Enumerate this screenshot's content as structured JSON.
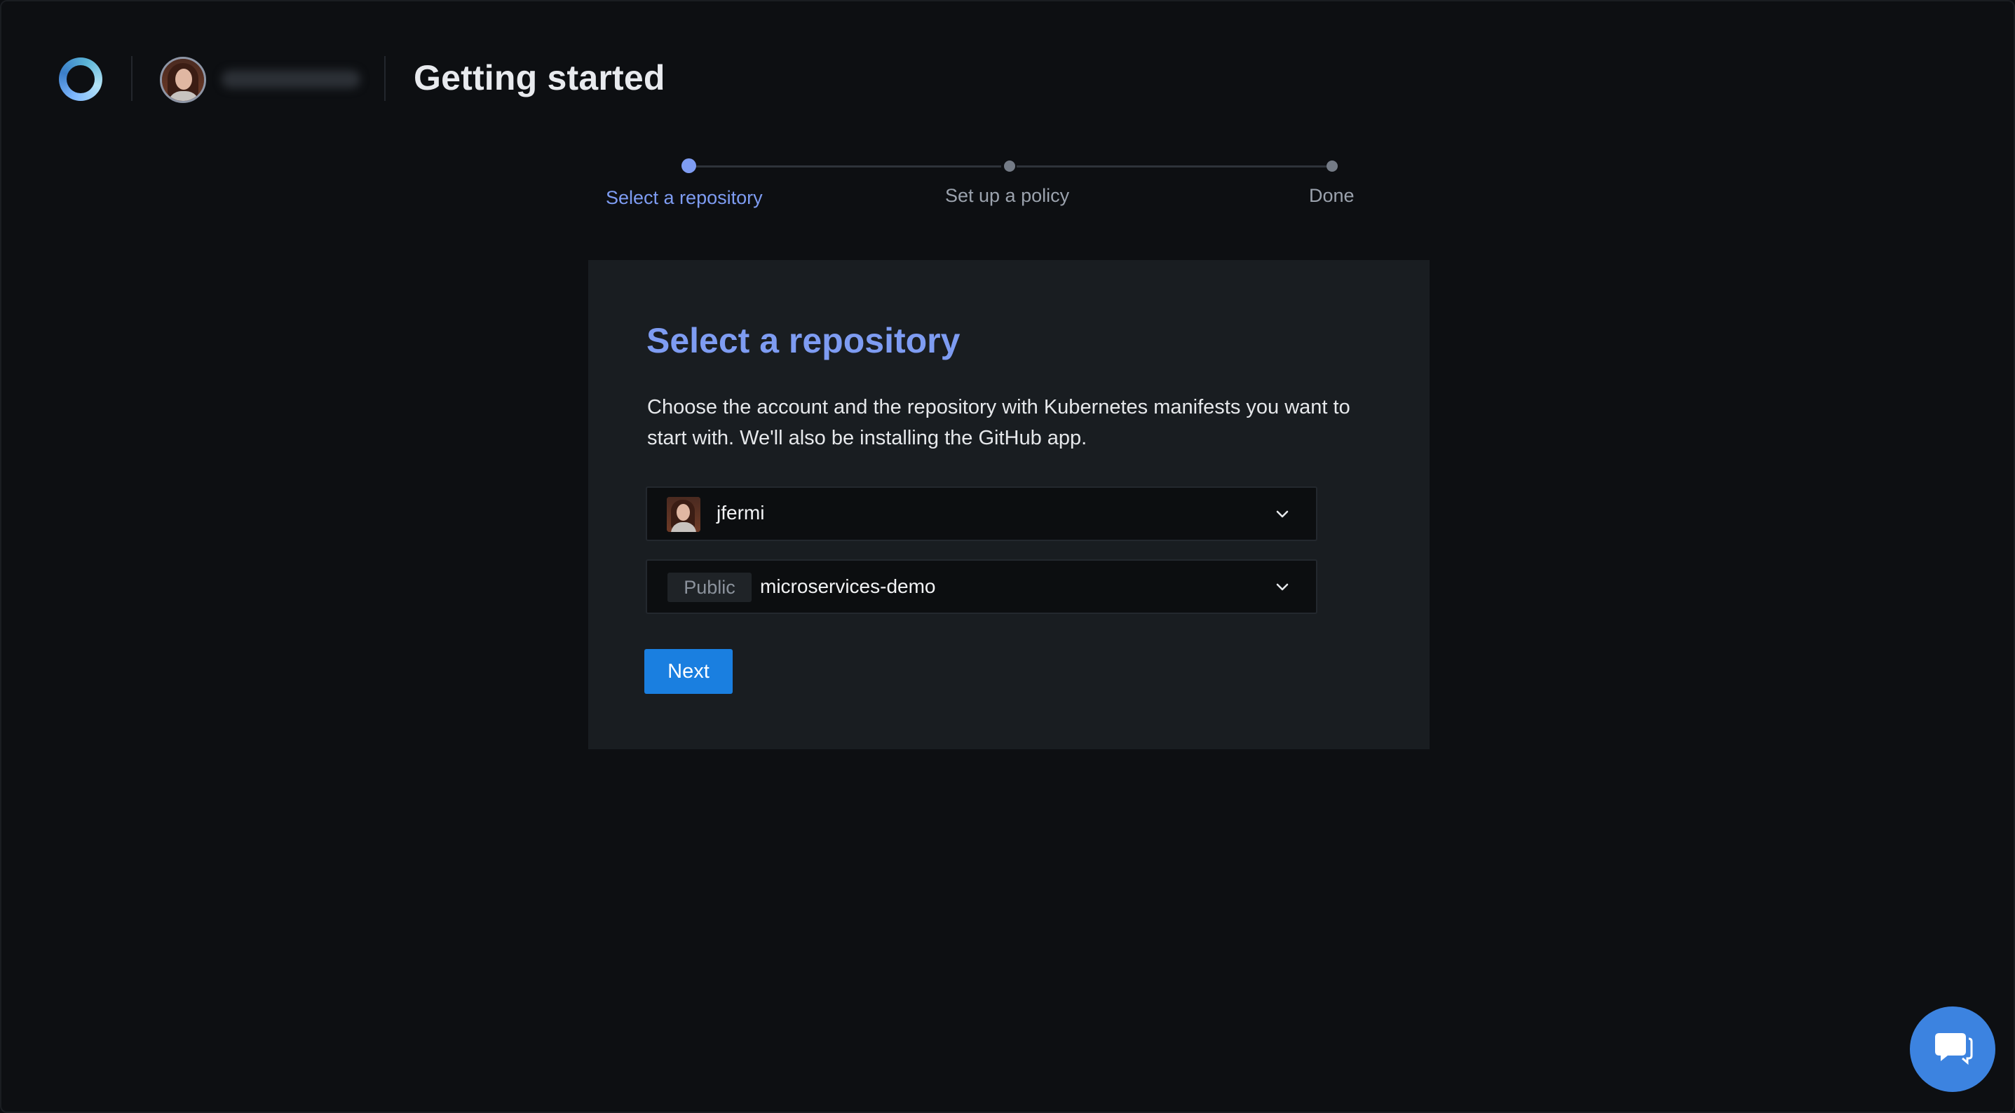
{
  "header": {
    "title": "Getting started",
    "logo_icon": "ring-logo-icon",
    "avatar_icon": "user-avatar"
  },
  "stepper": {
    "steps": [
      {
        "label": "Select a repository",
        "state": "active"
      },
      {
        "label": "Set up a policy",
        "state": "inactive"
      },
      {
        "label": "Done",
        "state": "inactive"
      }
    ]
  },
  "card": {
    "title": "Select a repository",
    "description": "Choose the account and the repository with Kubernetes manifests you want to start with. We'll also be installing the GitHub app.",
    "account_select": {
      "value": "jfermi"
    },
    "repo_select": {
      "visibility_badge": "Public",
      "value": "microservices-demo"
    },
    "next_label": "Next"
  },
  "colors": {
    "background": "#0d0f12",
    "card": "#191d21",
    "accent": "#7e9cf2",
    "primary_button": "#1a7fe0",
    "chat_button": "#3c83e0"
  }
}
